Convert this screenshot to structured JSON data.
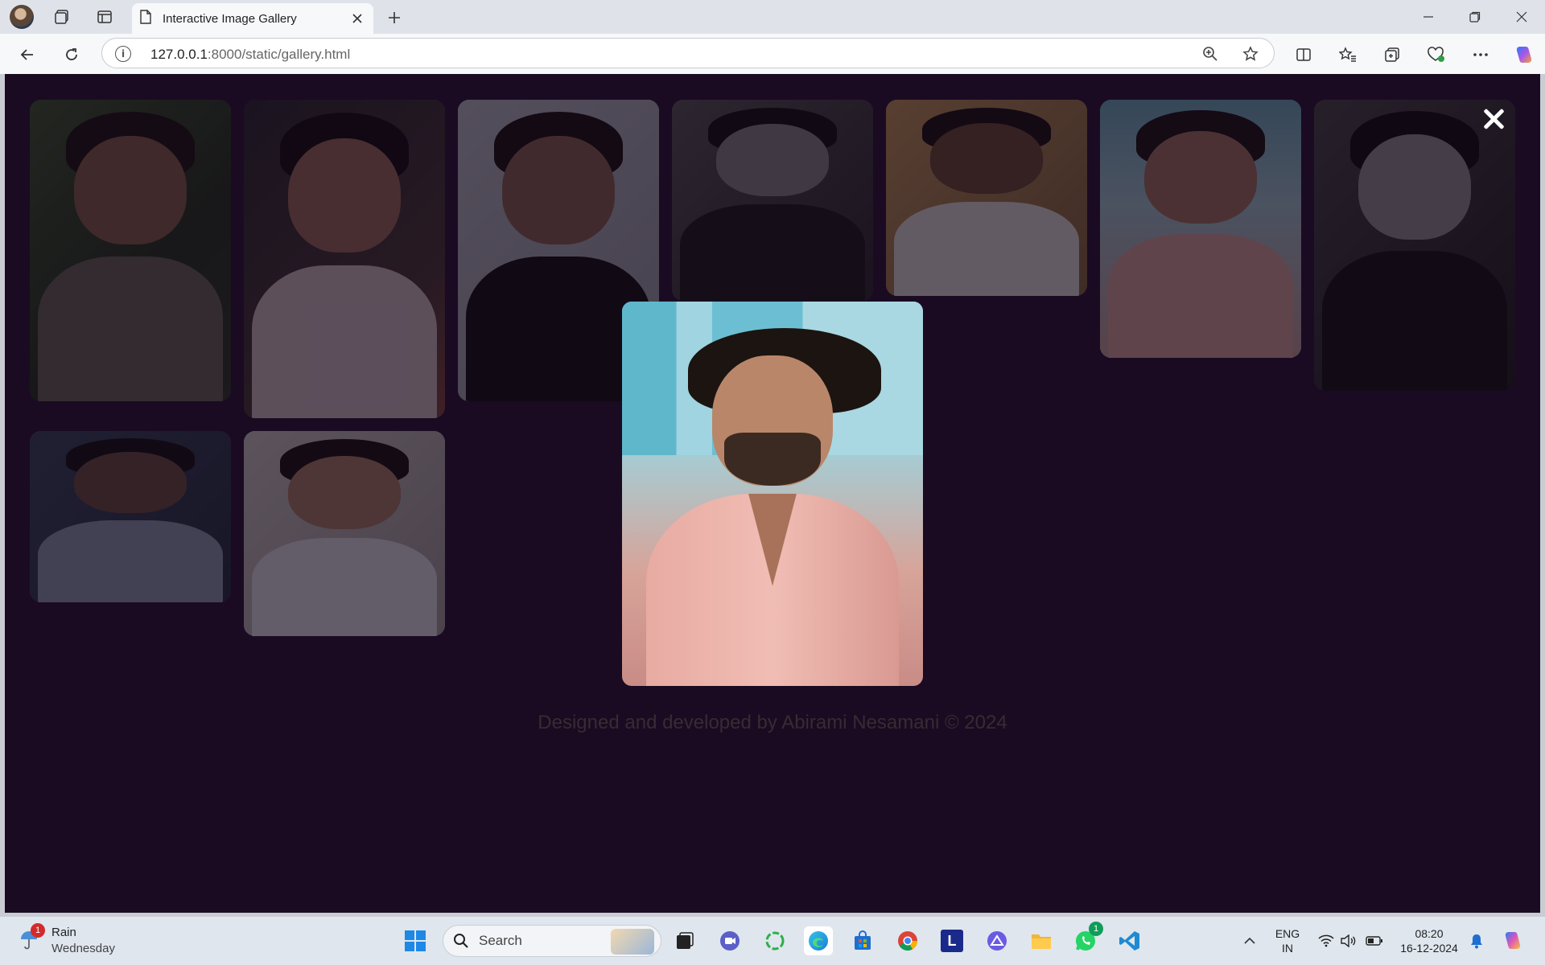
{
  "browser": {
    "tab_title": "Interactive Image Gallery",
    "url_host": "127.0.0.1",
    "url_path": ":8000/static/gallery.html"
  },
  "page": {
    "footer_text": "Designed and developed by Abirami Nesamani © 2024",
    "modal_open": true
  },
  "taskbar": {
    "weather_label": "Rain",
    "weather_day": "Wednesday",
    "weather_badge": "1",
    "search_placeholder": "Search",
    "whatsapp_badge": "1",
    "language": "ENG",
    "region": "IN",
    "time": "08:20",
    "date": "16-12-2024"
  },
  "colors": {
    "page_background": "#1a0b22",
    "taskbar_background": "#dfe6ee"
  }
}
